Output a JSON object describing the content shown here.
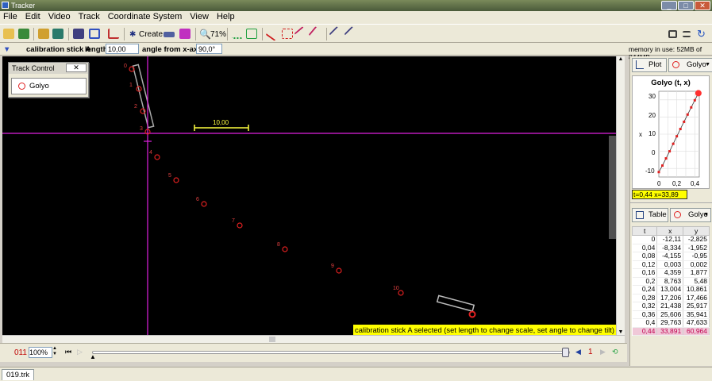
{
  "window": {
    "title": "Tracker"
  },
  "menu": [
    "File",
    "Edit",
    "Video",
    "Track",
    "Coordinate System",
    "View",
    "Help"
  ],
  "toolbar": {
    "create_label": "Create",
    "zoom_label": "71%"
  },
  "calibration": {
    "name": "calibration stick A",
    "length_label": "length",
    "length_value": "10,00",
    "angle_label": "angle from x-axis",
    "angle_value": "90,0°",
    "memory": "memory in use: 52MB of 844MB"
  },
  "video": {
    "stick_label": "10,00",
    "frame_labels": [
      "0",
      "1",
      "2",
      "3",
      "4",
      "5",
      "6",
      "7",
      "8",
      "9",
      "10"
    ],
    "status_message": "calibration stick A selected (set length to change scale, set angle to change tilt)"
  },
  "track_control": {
    "title": "Track Control",
    "close": "✕",
    "track": "Golyo"
  },
  "player": {
    "frame": "011",
    "zoom": "100%",
    "step": "1"
  },
  "plot": {
    "tab_label": "Plot",
    "track_label": "Golyo",
    "title": "Golyo (t, x)",
    "ylabel": "x",
    "readout": "t=0,44  x=33,89",
    "xticks": [
      "0",
      "0,2",
      "0,4"
    ],
    "yticks": [
      "30",
      "20",
      "10",
      "0",
      "-10"
    ]
  },
  "table": {
    "tab_label": "Table",
    "track_label": "Golyo",
    "headers": [
      "t",
      "x",
      "y"
    ],
    "rows": [
      [
        "0",
        "-12,11",
        "-2,825"
      ],
      [
        "0,04",
        "-8,334",
        "-1,952"
      ],
      [
        "0,08",
        "-4,155",
        "-0,95"
      ],
      [
        "0,12",
        "0,003",
        "0,002"
      ],
      [
        "0,16",
        "4,359",
        "1,877"
      ],
      [
        "0,2",
        "8,763",
        "5,48"
      ],
      [
        "0,24",
        "13,004",
        "10,861"
      ],
      [
        "0,28",
        "17,206",
        "17,466"
      ],
      [
        "0,32",
        "21,438",
        "25,917"
      ],
      [
        "0,36",
        "25,606",
        "35,941"
      ],
      [
        "0,4",
        "29,763",
        "47,633"
      ],
      [
        "0,44",
        "33,891",
        "60,964"
      ]
    ]
  },
  "chart_data": {
    "type": "scatter",
    "title": "Golyo (t, x)",
    "xlabel": "",
    "ylabel": "x",
    "x": [
      0,
      0.04,
      0.08,
      0.12,
      0.16,
      0.2,
      0.24,
      0.28,
      0.32,
      0.36,
      0.4,
      0.44
    ],
    "series": [
      {
        "name": "Golyo",
        "values": [
          -12.11,
          -8.334,
          -4.155,
          0.003,
          4.359,
          8.763,
          13.004,
          17.206,
          21.438,
          25.606,
          29.763,
          33.891
        ]
      }
    ],
    "xlim": [
      0,
      0.45
    ],
    "ylim": [
      -15,
      35
    ],
    "grid": true
  },
  "status": {
    "file_tab": "019.trk"
  },
  "colors": {
    "accent": "#e020e0",
    "marker": "#e02020",
    "readout_bg": "#ffff00"
  }
}
